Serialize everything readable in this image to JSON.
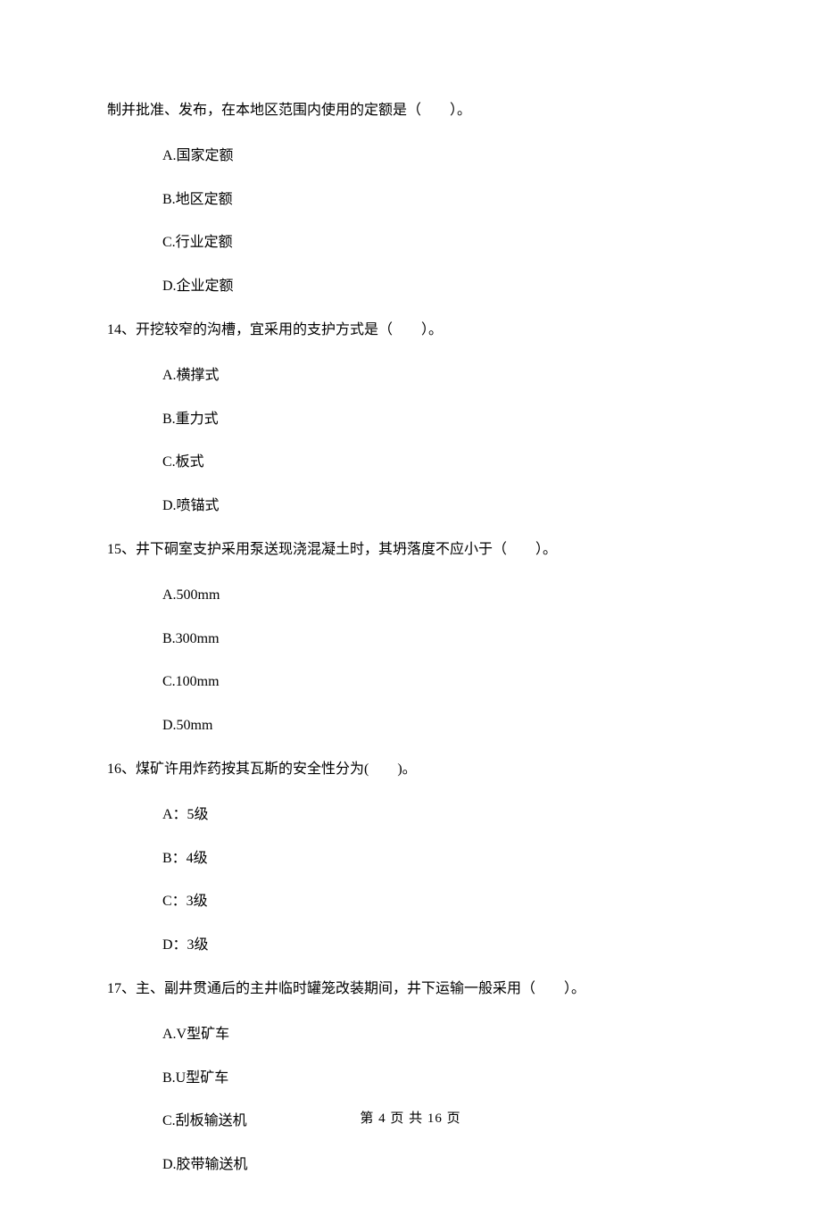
{
  "lead_in": "制并批准、发布，在本地区范围内使用的定额是（　　）。",
  "lead_in_options": [
    "A.国家定额",
    "B.地区定额",
    "C.行业定额",
    "D.企业定额"
  ],
  "questions": [
    {
      "stem": "14、开挖较窄的沟槽，宜采用的支护方式是（　　）。",
      "options": [
        "A.横撑式",
        "B.重力式",
        "C.板式",
        "D.喷锚式"
      ]
    },
    {
      "stem": "15、井下硐室支护采用泵送现浇混凝土时，其坍落度不应小于（　　）。",
      "options": [
        "A.500mm",
        "B.300mm",
        "C.100mm",
        "D.50mm"
      ]
    },
    {
      "stem": "16、煤矿许用炸药按其瓦斯的安全性分为(　　)。",
      "options": [
        "A：5级",
        "B：4级",
        "C：3级",
        "D：3级"
      ]
    },
    {
      "stem": "17、主、副井贯通后的主井临时罐笼改装期间，井下运输一般采用（　　）。",
      "options": [
        "A.V型矿车",
        "B.U型矿车",
        "C.刮板输送机",
        "D.胶带输送机"
      ]
    }
  ],
  "footer": "第 4 页 共 16 页"
}
